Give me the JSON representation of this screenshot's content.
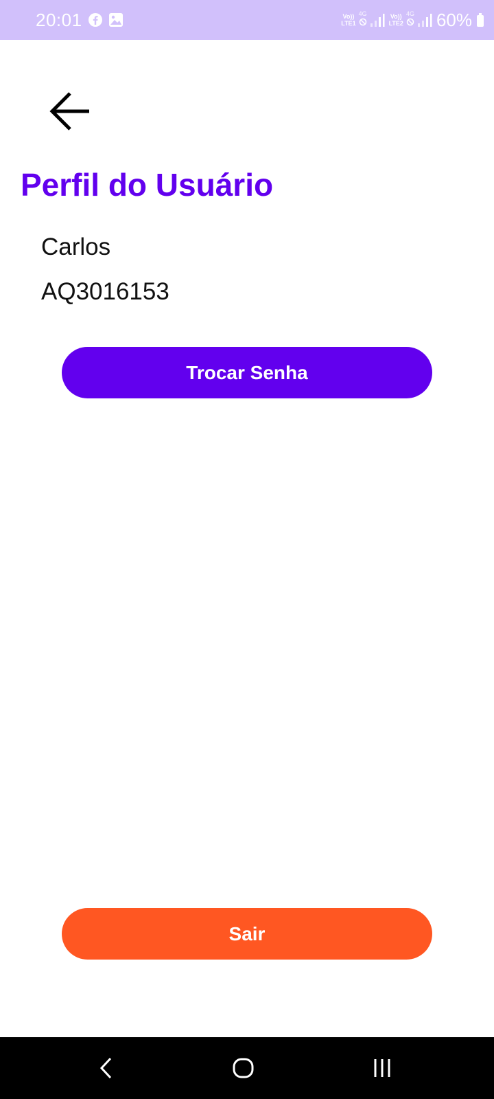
{
  "status_bar": {
    "time": "20:01",
    "notification_icons": [
      "facebook-icon",
      "gallery-icon"
    ],
    "sim1": {
      "volte": "Vo))",
      "lte": "LTE1",
      "network": "4G"
    },
    "sim2": {
      "volte": "Vo))",
      "lte": "LTE2",
      "network": "4G"
    },
    "battery": "60%",
    "background_color": "#d1c0fb"
  },
  "header": {
    "back_icon": "arrow-left-icon",
    "title": "Perfil do Usuário",
    "title_color": "#6200ee"
  },
  "profile": {
    "name": "Carlos",
    "user_id": "AQ3016153"
  },
  "actions": {
    "change_password_label": "Trocar Senha",
    "change_password_color": "#6200ee",
    "logout_label": "Sair",
    "logout_color": "#ff5722"
  },
  "navigation_bar": {
    "buttons": [
      "back-icon",
      "home-icon",
      "recents-icon"
    ]
  }
}
